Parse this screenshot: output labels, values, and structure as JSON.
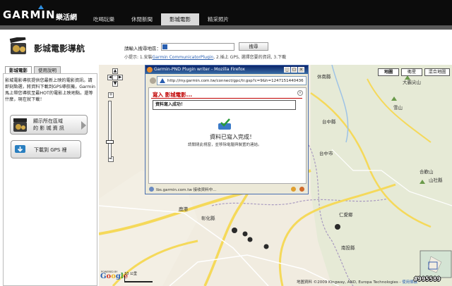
{
  "header": {
    "brand": "GARMIN.",
    "brand_sub": "樂活網",
    "nav": [
      {
        "label": "吃喝玩樂",
        "active": false
      },
      {
        "label": "休閒新聞",
        "active": false
      },
      {
        "label": "影城電影",
        "active": true
      },
      {
        "label": "精采照片",
        "active": false
      }
    ]
  },
  "page": {
    "title": "影城電影導航",
    "search_label": "請輸入搜尋地區：",
    "search_value": "",
    "search_button": "搜尋",
    "hint_prefix": "小提示: 1.安裝",
    "hint_link": "Garmin CommunicatorPlugin",
    "hint_suffix": ", 2.插上 GPS, 選擇您要的資訊, 3.下載"
  },
  "sidebar": {
    "tabs": [
      {
        "label": "影城電影",
        "active": true
      },
      {
        "label": "使用說明",
        "active": false
      }
    ],
    "description": "影城電影導航提供您最新上映的電影資訊。請即刻點選，將資料下載到GPS導航機，Garmin馬上帶您導航至最HOT的電影上映地點。還等什麼，現在就下載！",
    "show_area_line1": "顯示所在區域",
    "show_area_line2": "的 影 城 資 訊",
    "download_label": "下載到 GPS 裡"
  },
  "map": {
    "types": [
      {
        "label": "地圖",
        "active": true
      },
      {
        "label": "衛星",
        "active": false
      },
      {
        "label": "混合地圖",
        "active": false
      }
    ],
    "places": [
      "休南縣",
      "大霸尖山",
      "雪山",
      "台中縣",
      "台中市",
      "彰化縣",
      "南投縣",
      "合歡山",
      "山社縣",
      "仁愛鄉",
      "鹿港"
    ],
    "zoom_in": "+",
    "zoom_out": "−",
    "scale_km": "10 公里",
    "scale_mi": "5 英里",
    "google": "Google",
    "powered": "POWERED BY",
    "copyright": "地圖資料 ©2009 Kingway, AND, Europa Technologies - ",
    "terms": "使用條款"
  },
  "popup": {
    "window_title": "Garmin-PND Plugin writer - Mozilla Firefox",
    "url": "http://my.garmin.com.tw/connect/gpc/tr.gsp?c=9&h=1247151440436",
    "heading": "寫入 影城電影...",
    "close_symbol": "×",
    "success_msg": "資料寫入成功！",
    "done_text": "資料已寫入完成！",
    "note": "請關閉此視窗，並移除電腦與裝置的連結。",
    "status": "lbs.garmin.com.tw 接收資料中..."
  },
  "watermark": "#995589",
  "colors": {
    "topbar": "#0c0c0c",
    "accent_blue": "#2f8fe0",
    "popup_heading": "#c00000",
    "map_land": "#f1ece0",
    "road_yellow": "#f5d95a"
  }
}
